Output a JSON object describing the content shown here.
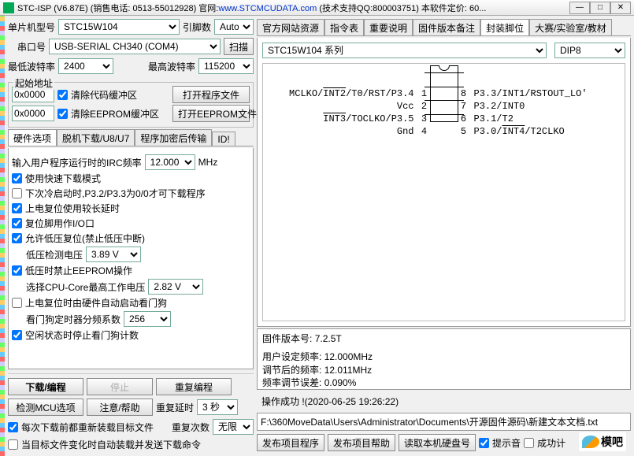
{
  "title": {
    "app": "STC-ISP (V6.87E)",
    "sales": "(销售电话: 0513-55012928) 官网:",
    "url": "www.STCMCUDATA.com",
    "tech": "(技术支持QQ:800003751) 本软件定价: 60..."
  },
  "left": {
    "mcu_label": "单片机型号",
    "mcu_model": "STC15W104",
    "pin_label": "引脚数",
    "pin_value": "Auto",
    "port_label": "串口号",
    "port_value": "USB-SERIAL CH340 (COM4)",
    "scan_btn": "扫描",
    "minbaud_label": "最低波特率",
    "minbaud": "2400",
    "maxbaud_label": "最高波特率",
    "maxbaud": "115200",
    "addr_legend": "起始地址",
    "addr_code": "0x0000",
    "clear_code": "清除代码缓冲区",
    "open_code": "打开程序文件",
    "addr_eep": "0x0000",
    "clear_eep": "清除EEPROM缓冲区",
    "open_eep": "打开EEPROM文件",
    "tabs": [
      "硬件选项",
      "脱机下载/U8/U7",
      "程序加密后传输",
      "ID!"
    ],
    "hw": {
      "irc_label": "输入用户程序运行时的IRC频率",
      "irc_value": "12.000",
      "irc_unit": "MHz",
      "c1": "使用快速下载模式",
      "c2": "下次冷启动时,P3.2/P3.3为0/0才可下载程序",
      "c3": "上电复位使用较长延时",
      "c4": "复位脚用作I/O口",
      "c5": "允许低压复位(禁止低压中断)",
      "lv_label": "低压检测电压",
      "lv_value": "3.89 V",
      "c6": "低压时禁止EEPROM操作",
      "cpu_label": "选择CPU-Core最高工作电压",
      "cpu_value": "2.82 V",
      "c7": "上电复位时由硬件自动启动看门狗",
      "wdt_label": "看门狗定时器分频系数",
      "wdt_value": "256",
      "c8": "空闲状态时停止看门狗计数"
    },
    "dl_btn": "下载/编程",
    "stop_btn": "停止",
    "reprog_btn": "重复编程",
    "detect_btn": "检测MCU选项",
    "help_btn": "注意/帮助",
    "redelay_label": "重复延时",
    "redelay_value": "3 秒",
    "recount_label": "重复次数",
    "recount_value": "无限",
    "cb1": "每次下载前都重新装载目标文件",
    "cb2": "当目标文件变化时自动装载并发送下载命令"
  },
  "right": {
    "tabs": [
      "官方网站资源",
      "指令表",
      "重要说明",
      "固件版本备注",
      "封装脚位",
      "大赛/实验室/教材"
    ],
    "active_tab_index": 4,
    "series_value": "STC15W104 系列",
    "package_value": "DIP8",
    "pins_left": [
      {
        "label": "MCLKO/INT2/T0/RST/P3.4",
        "num": "1"
      },
      {
        "label": "Vcc",
        "num": "2"
      },
      {
        "label": "INT3/TOCLKO/P3.5",
        "num": "3"
      },
      {
        "label": "Gnd",
        "num": "4"
      }
    ],
    "pins_right": [
      {
        "num": "8",
        "label": "P3.3/INT1/RSTOUT_LO"
      },
      {
        "num": "7",
        "label": "P3.2/INT0"
      },
      {
        "num": "6",
        "label": "P3.1/T2"
      },
      {
        "num": "5",
        "label": "P3.0/INT4/T2CLKO"
      }
    ],
    "fw_label": "固件版本号:",
    "fw_value": "7.2.5T",
    "user_freq_label": "用户设定频率:",
    "user_freq_value": "12.000MHz",
    "adj_freq_label": "调节后的频率:",
    "adj_freq_value": "12.011MHz",
    "err_label": "频率调节误差:",
    "err_value": "0.090%",
    "status": "操作成功 !(2020-06-25 19:26:22)",
    "path": "F:\\360MoveData\\Users\\Administrator\\Documents\\开源固件源码\\新建文本文档.txt",
    "btn1": "发布项目程序",
    "btn2": "发布项目帮助",
    "btn3": "读取本机硬盘号",
    "cb_tone": "提示音",
    "cb_ok": "成功计",
    "logo": "模吧"
  }
}
